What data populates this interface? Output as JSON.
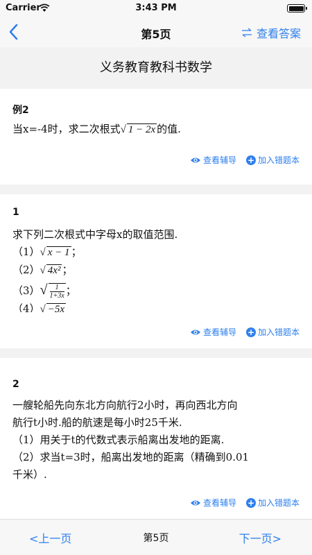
{
  "status": {
    "carrier": "Carrier",
    "time": "3:43 PM"
  },
  "nav": {
    "title": "第5页",
    "answer_label": "查看答案"
  },
  "book_title": "义务教育教科书数学",
  "cards": [
    {
      "label": "例2",
      "text_prefix": "当x=-4时，求二次根式",
      "radicand": "1 − 2x",
      "text_suffix": "的值."
    },
    {
      "label": "1",
      "stem": "求下列二次根式中字母x的取值范围.",
      "items": [
        {
          "num": "（1）",
          "expr": "x − 1",
          "end": "；"
        },
        {
          "num": "（2）",
          "expr": "4x²",
          "end": "；"
        },
        {
          "num": "（3）",
          "frac_top": "1",
          "frac_bottom": "1+3x",
          "end": "；"
        },
        {
          "num": "（4）",
          "expr": "−5x",
          "end": ""
        }
      ]
    },
    {
      "label": "2",
      "lines": [
        "一艘轮船先向东北方向航行2小时，再向西北方向",
        "航行t小时.船的航速是每小时25千米.",
        "（1）用关于t的代数式表示船离出发地的距离.",
        "（2）求当t=3时，船离出发地的距离（精确到0.01",
        "千米）."
      ]
    }
  ],
  "actions": {
    "hint": "查看辅导",
    "add_wrong": "加入错题本",
    "plus_icon": "+"
  },
  "bottom": {
    "prev": "<上一页",
    "page": "第5页",
    "next": "下一页>"
  },
  "colors": {
    "accent": "#2f80ed"
  }
}
